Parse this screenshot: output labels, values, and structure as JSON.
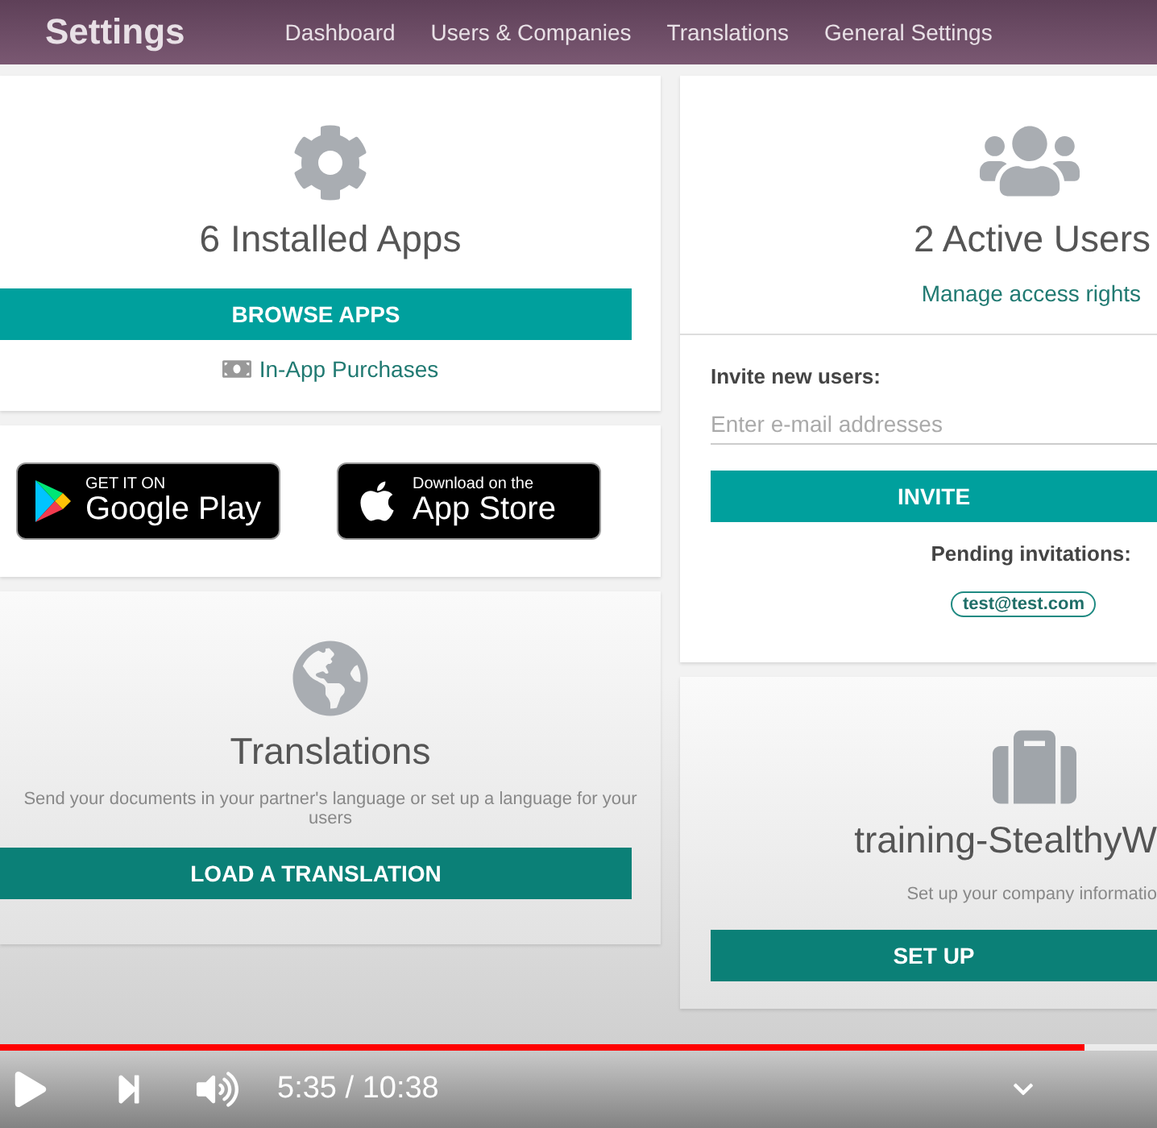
{
  "header": {
    "title": "Settings",
    "nav": [
      {
        "label": "Dashboard"
      },
      {
        "label": "Users & Companies"
      },
      {
        "label": "Translations"
      },
      {
        "label": "General Settings"
      }
    ]
  },
  "apps_card": {
    "title": "6 Installed Apps",
    "button": "BROWSE APPS",
    "link": "In-App Purchases"
  },
  "store_badges": [
    {
      "kind": "google",
      "small": "GET IT ON",
      "big": "Google Play"
    },
    {
      "kind": "apple",
      "small": "Download on the",
      "big": "App Store"
    }
  ],
  "translations_card": {
    "title": "Translations",
    "description": "Send your documents in your partner's language or set up a language for your users",
    "button": "LOAD A TRANSLATION"
  },
  "users_card": {
    "title": "2 Active Users",
    "link": "Manage access rights",
    "invite_label": "Invite new users:",
    "email_field": {
      "placeholder": "Enter e-mail addresses"
    },
    "invite_button": "INVITE",
    "pending_label": "Pending invitations:",
    "pending": [
      "test@test.com"
    ]
  },
  "company_card": {
    "title": "training-StealthyW",
    "description": "Set up your company informatio",
    "button": "SET UP"
  },
  "player": {
    "progress": {
      "level": 0.937
    },
    "time": "5:35 / 10:38"
  }
}
